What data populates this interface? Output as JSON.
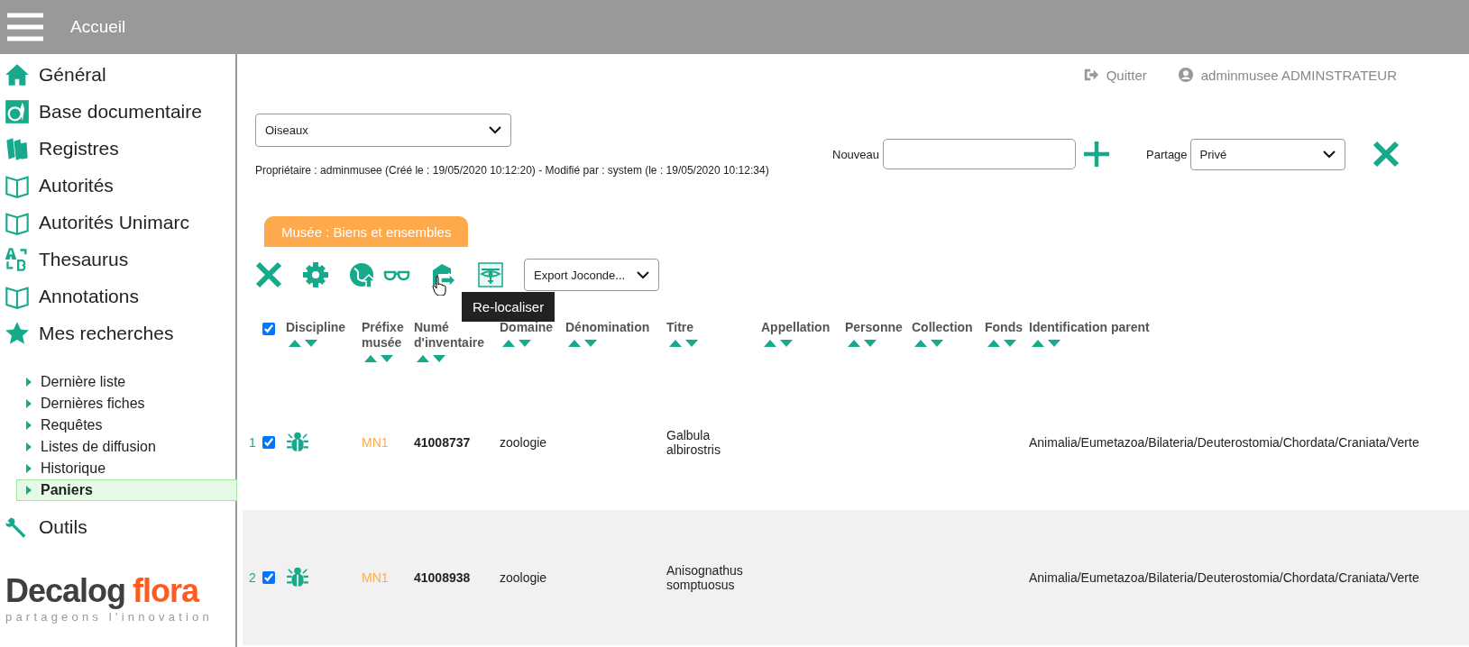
{
  "topbar": {
    "title": "Accueil"
  },
  "sidebar": {
    "items": [
      {
        "label": "Général",
        "kind": "house"
      },
      {
        "label": "Base documentaire",
        "kind": "doc"
      },
      {
        "label": "Registres",
        "kind": "books"
      },
      {
        "label": "Autorités",
        "kind": "book"
      },
      {
        "label": "Autorités Unimarc",
        "kind": "book"
      },
      {
        "label": "Thesaurus",
        "kind": "ab"
      },
      {
        "label": "Annotations",
        "kind": "book"
      },
      {
        "label": "Mes recherches",
        "kind": "star",
        "children": [
          {
            "label": "Dernière liste",
            "selected": false
          },
          {
            "label": "Dernières fiches",
            "selected": false
          },
          {
            "label": "Requêtes",
            "selected": false
          },
          {
            "label": "Listes de diffusion",
            "selected": false
          },
          {
            "label": "Historique",
            "selected": false
          },
          {
            "label": "Paniers",
            "selected": true
          }
        ]
      },
      {
        "label": "Outils",
        "kind": "wrench"
      }
    ],
    "logo": {
      "word1": "Decalog",
      "word2": "flora",
      "tagline": "partageons l'innovation"
    }
  },
  "userbar": {
    "quit": "Quitter",
    "user": "adminmusee ADMINSTRATEUR"
  },
  "basket": {
    "select": "Oiseaux",
    "meta": "Propriétaire : adminmusee (Créé le : 19/05/2020 10:12:20) - Modifié par : system (le : 19/05/2020 10:12:34)",
    "new_label": "Nouveau",
    "share_label": "Partage",
    "share_value": "Privé"
  },
  "tab": {
    "label": "Musée : Biens et ensembles"
  },
  "toolbar": {
    "export": "Export Joconde...",
    "tooltip": "Re-localiser"
  },
  "table": {
    "all_checked": true,
    "columns": [
      {
        "lines": [
          "Discipline"
        ]
      },
      {
        "lines": [
          "Préfixe",
          "musée"
        ]
      },
      {
        "lines": [
          "Numé",
          "d'inventaire"
        ]
      },
      {
        "lines": [
          "Domaine"
        ]
      },
      {
        "lines": [
          "Dénomination"
        ]
      },
      {
        "lines": [
          "Titre"
        ]
      },
      {
        "lines": [
          "Appellation"
        ]
      },
      {
        "lines": [
          "Personne"
        ]
      },
      {
        "lines": [
          "Collection"
        ]
      },
      {
        "lines": [
          "Fonds"
        ]
      },
      {
        "lines": [
          "Identification parent"
        ]
      }
    ],
    "rows": [
      {
        "number": "1",
        "checked": true,
        "prefix": "MN1",
        "inventory": "41008737",
        "domain": "zoologie",
        "title": "Galbula albirostris",
        "parent": "Animalia/Eumetazoa/Bilateria/Deuterostomia/Chordata/Craniata/Verte"
      },
      {
        "number": "2",
        "checked": true,
        "prefix": "MN1",
        "inventory": "41008938",
        "domain": "zoologie",
        "title": "Anisognathus somptuosus",
        "parent": "Animalia/Eumetazoa/Bilateria/Deuterostomia/Chordata/Craniata/Verte"
      }
    ]
  }
}
